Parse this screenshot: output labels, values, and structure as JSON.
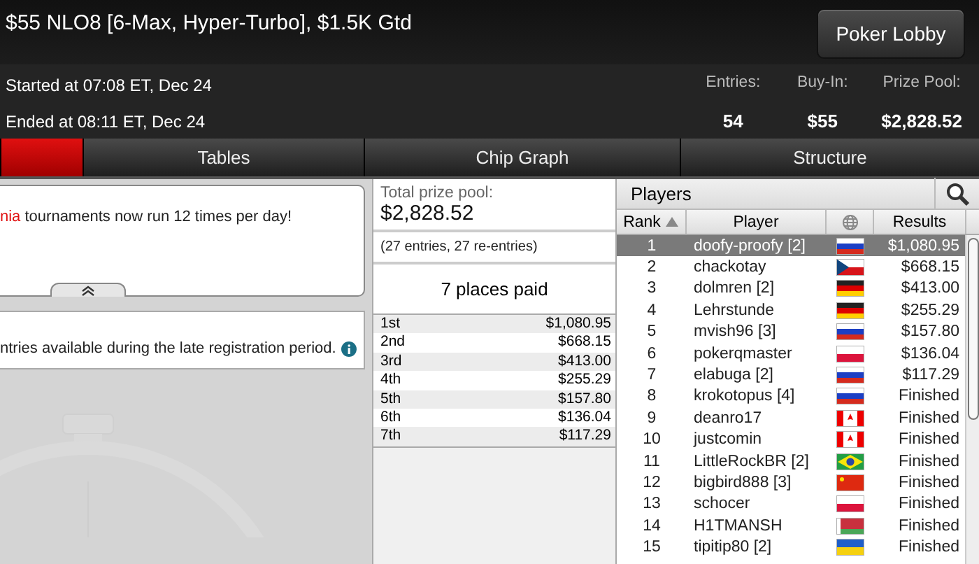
{
  "header": {
    "title": "$55 NLO8 [6-Max, Hyper-Turbo], $1.5K Gtd",
    "lobby_button": "Poker Lobby",
    "started": "Started at 07:08 ET, Dec 24",
    "ended": "Ended at 08:11 ET, Dec 24",
    "stats": [
      {
        "label": "Entries:",
        "value": "54"
      },
      {
        "label": "Buy-In:",
        "value": "$55"
      },
      {
        "label": "Prize Pool:",
        "value": "$2,828.52"
      }
    ]
  },
  "tabs": [
    {
      "selected": true
    },
    {
      "label": "Tables",
      "selected": false
    },
    {
      "label": "Chip Graph",
      "selected": false
    },
    {
      "label": "Structure",
      "selected": false
    }
  ],
  "news": {
    "highlight": "nia",
    "text": " tournaments now run 12 times per day!"
  },
  "notice": {
    "text": "ntries available during the late registration period."
  },
  "prizes": {
    "total_label": "Total prize pool:",
    "total": "$2,828.52",
    "entries": "(27 entries, 27 re-entries)",
    "places_paid": "7 places paid",
    "places": [
      {
        "place": "1st",
        "amount": "$1,080.95"
      },
      {
        "place": "2nd",
        "amount": "$668.15"
      },
      {
        "place": "3rd",
        "amount": "$413.00"
      },
      {
        "place": "4th",
        "amount": "$255.29"
      },
      {
        "place": "5th",
        "amount": "$157.80"
      },
      {
        "place": "6th",
        "amount": "$136.04"
      },
      {
        "place": "7th",
        "amount": "$117.29"
      }
    ]
  },
  "players": {
    "title": "Players",
    "columns": [
      {
        "label": "Rank",
        "sorted": true
      },
      {
        "label": "Player",
        "sorted": false
      },
      {
        "sorted": false
      },
      {
        "label": "Results",
        "sorted": false
      }
    ],
    "rows": [
      {
        "rank": "1",
        "player": "doofy-proofy [2]",
        "kind": "ru",
        "result": "$1,080.95",
        "selected": true
      },
      {
        "rank": "2",
        "player": "chackotay",
        "kind": "cz",
        "result": "$668.15",
        "selected": false
      },
      {
        "rank": "3",
        "player": "dolmren [2]",
        "kind": "de",
        "result": "$413.00",
        "selected": false
      },
      {
        "rank": "4",
        "player": "Lehrstunde",
        "kind": "de",
        "result": "$255.29",
        "selected": false
      },
      {
        "rank": "5",
        "player": "mvish96 [3]",
        "kind": "ru",
        "result": "$157.80",
        "selected": false
      },
      {
        "rank": "6",
        "player": "pokerqmaster",
        "kind": "pl",
        "result": "$136.04",
        "selected": false
      },
      {
        "rank": "7",
        "player": "elabuga [2]",
        "kind": "ru",
        "result": "$117.29",
        "selected": false
      },
      {
        "rank": "8",
        "player": "krokotopus [4]",
        "kind": "ru",
        "result": "Finished",
        "selected": false
      },
      {
        "rank": "9",
        "player": "deanro17",
        "kind": "ca",
        "result": "Finished",
        "selected": false
      },
      {
        "rank": "10",
        "player": "justcomin",
        "kind": "ca",
        "result": "Finished",
        "selected": false
      },
      {
        "rank": "11",
        "player": "LittleRockBR [2]",
        "kind": "br",
        "result": "Finished",
        "selected": false
      },
      {
        "rank": "12",
        "player": "bigbird888 [3]",
        "kind": "cn",
        "result": "Finished",
        "selected": false
      },
      {
        "rank": "13",
        "player": "schocer",
        "kind": "pl",
        "result": "Finished",
        "selected": false
      },
      {
        "rank": "14",
        "player": "H1TMANSH",
        "kind": "by",
        "result": "Finished",
        "selected": false
      },
      {
        "rank": "15",
        "player": "tipitip80 [2]",
        "kind": "ua",
        "result": "Finished",
        "selected": false
      }
    ]
  }
}
